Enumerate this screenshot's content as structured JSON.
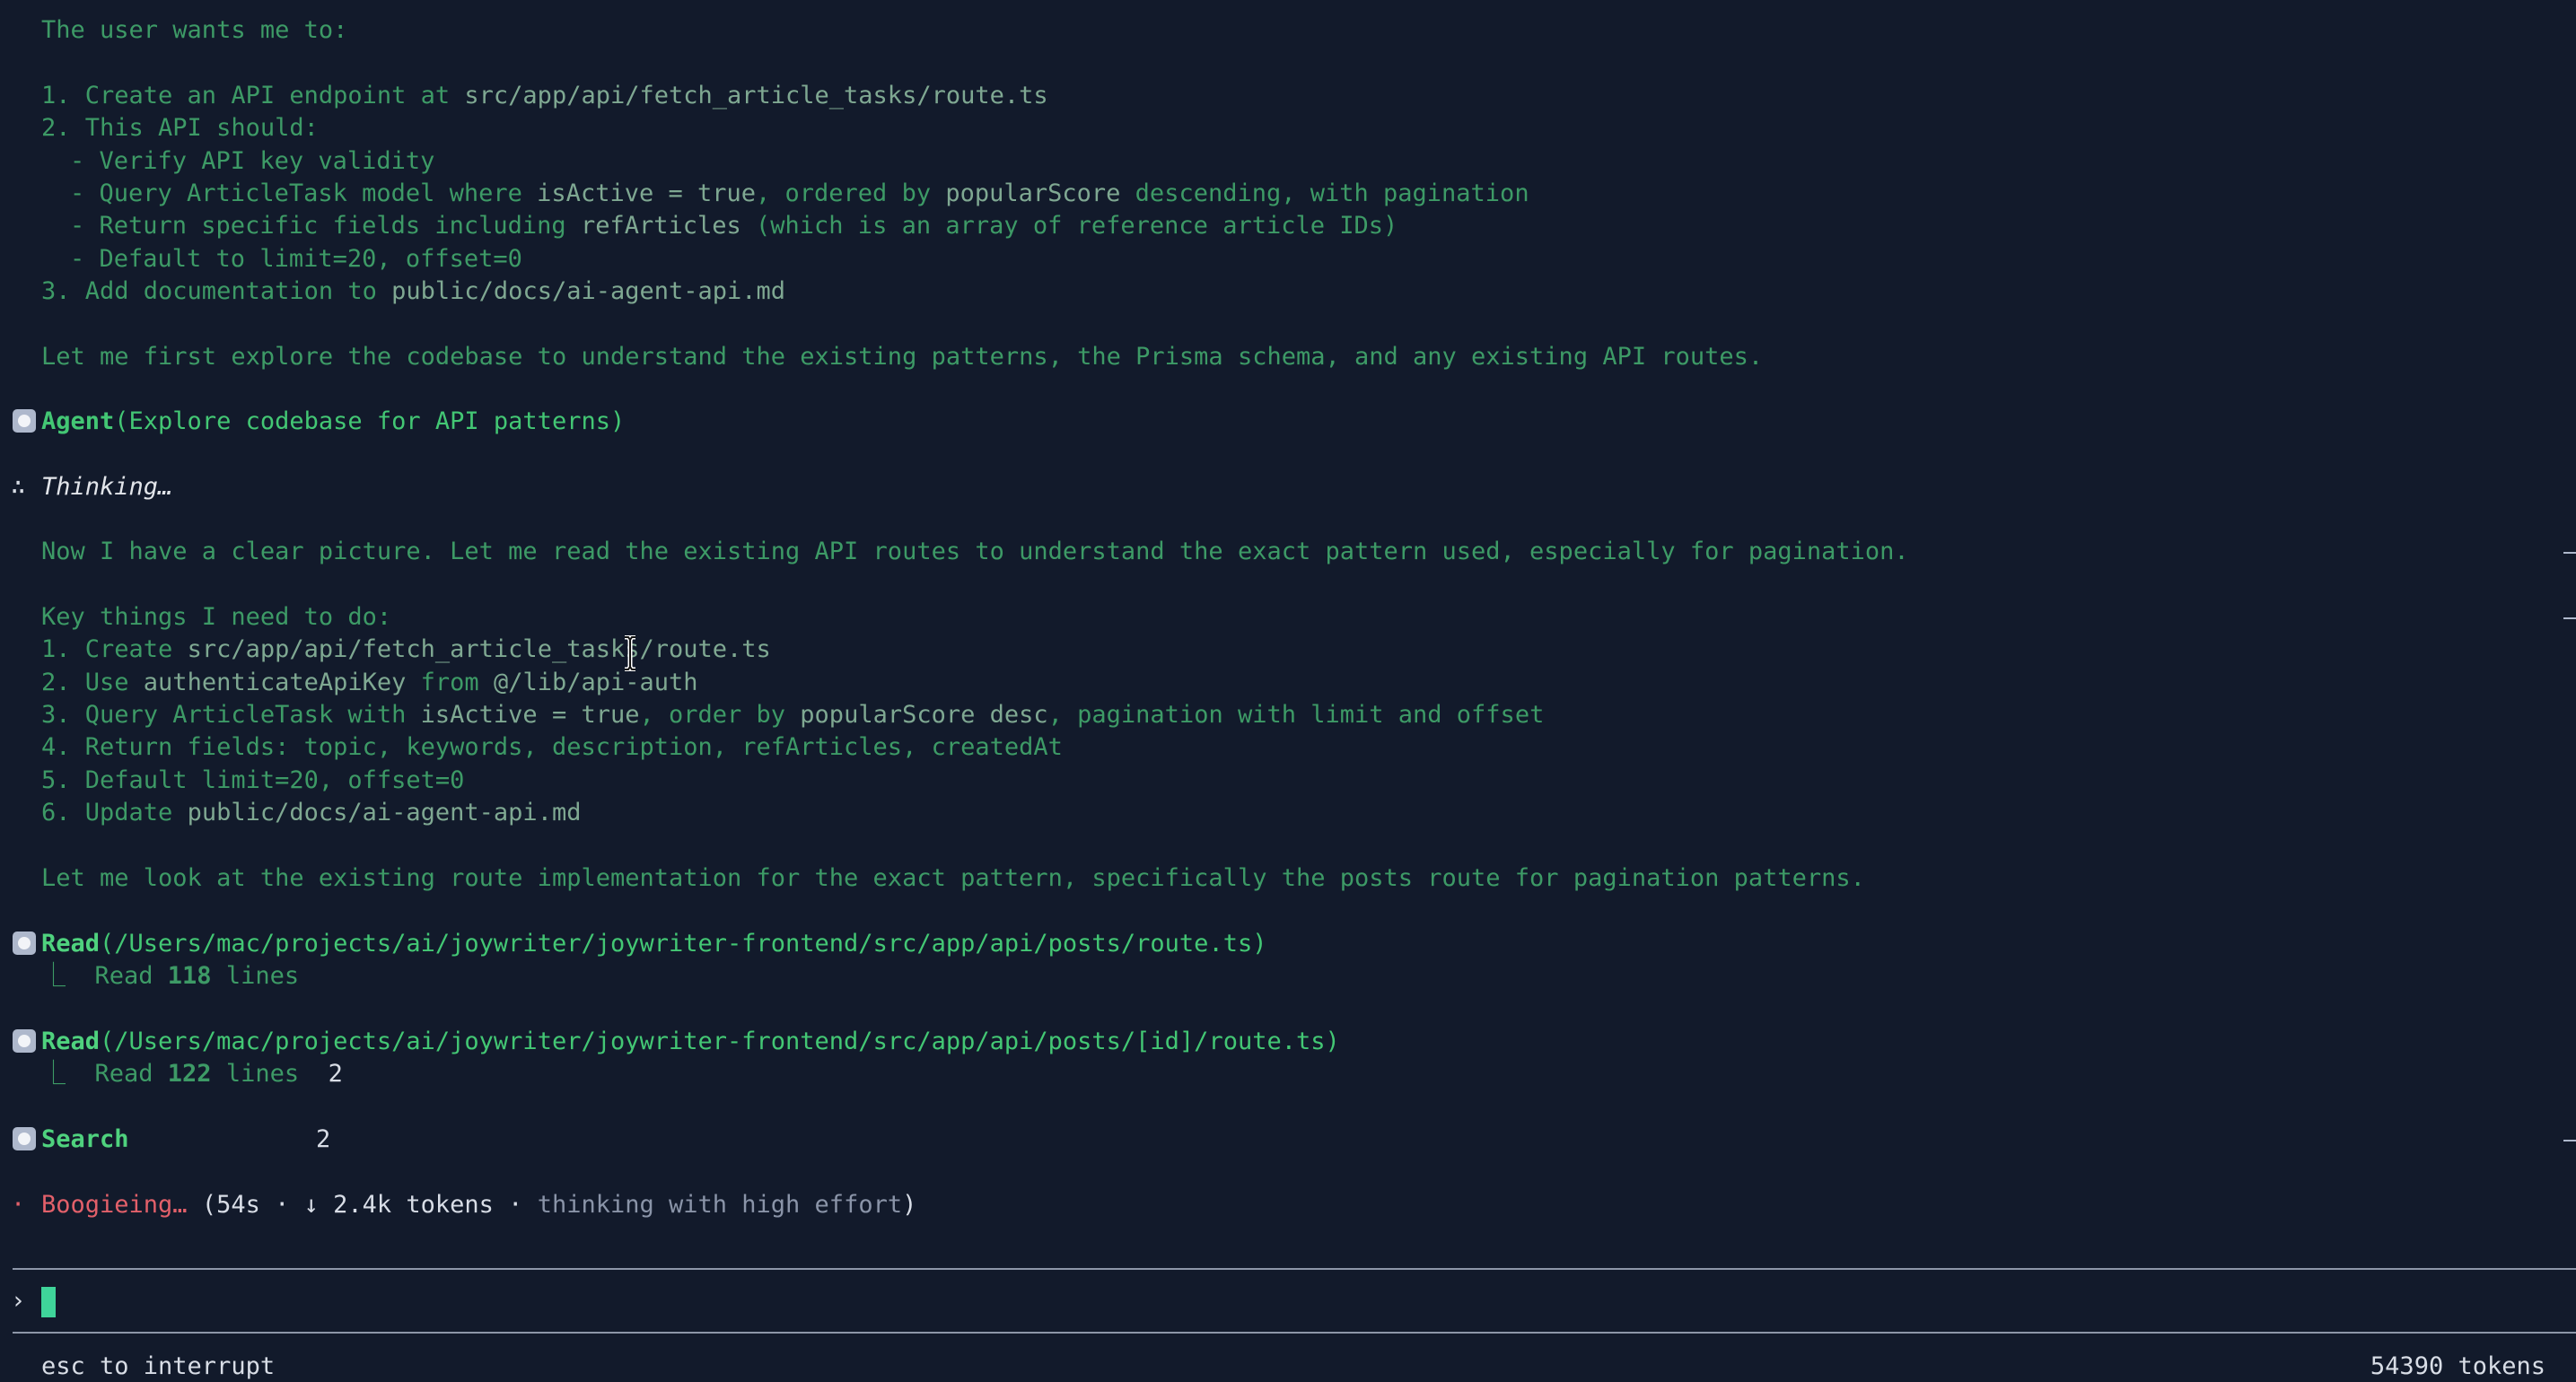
{
  "intro": {
    "line1": "The user wants me to:",
    "l2": "1. Create an API endpoint at ",
    "l2_path": "src/app/api/fetch_article_tasks/route.ts",
    "l3": "2. This API should:",
    "l4": "- Verify API key validity",
    "l5a": "- Query ArticleTask model where ",
    "l5b": "isActive = true",
    "l5c": ", ordered by ",
    "l5d": "popularScore",
    "l5e": " descending, with pagination",
    "l6a": "- Return specific fields including ",
    "l6b": "refArticles",
    "l6c": " (which is an array of reference article IDs)",
    "l7": "- Default to limit=20, offset=0",
    "l8a": "3. Add documentation to ",
    "l8b": "public/docs/ai-agent-api.md",
    "l9": "Let me first explore the codebase to understand the existing patterns, the Prisma schema, and any existing API routes."
  },
  "agent": {
    "name": "Agent",
    "args": "(Explore codebase for API patterns)"
  },
  "thinking": {
    "glyph": "∴",
    "label": "Thinking…",
    "p1": "Now I have a clear picture. Let me read the existing API routes to understand the exact pattern used, especially for pagination.",
    "key_title": "Key things I need to do:",
    "k1a": "1. Create ",
    "k1b": "src/app/api/fetch_article_tasks/route.ts",
    "k2a": "2. Use ",
    "k2b": "authenticateApiKey",
    "k2c": " from ",
    "k2d": "@/lib/api-auth",
    "k3a": "3. Query ArticleTask with ",
    "k3b": "isActive = true",
    "k3c": ", order by ",
    "k3d": "popularScore desc",
    "k3e": ", pagination with limit and offset",
    "k4": "4. Return fields: topic, keywords, description, refArticles, createdAt",
    "k5": "5. Default limit=20, offset=0",
    "k6a": "6. Update ",
    "k6b": "public/docs/ai-agent-api.md",
    "p2": "Let me look at the existing route implementation for the exact pattern, specifically the posts route for pagination patterns."
  },
  "tools": [
    {
      "name": "Read",
      "args": "(/Users/mac/projects/ai/joywriter/joywriter-frontend/src/app/api/posts/route.ts)",
      "result_prefix": "⎿  Read ",
      "result_count": "118",
      "result_suffix": " lines",
      "extra": ""
    },
    {
      "name": "Read",
      "args": "(/Users/mac/projects/ai/joywriter/joywriter-frontend/src/app/api/posts/[id]/route.ts)",
      "result_prefix": "⎿  Read ",
      "result_count": "122",
      "result_suffix": " lines",
      "extra": "2"
    },
    {
      "name": "Search",
      "extra": "2"
    }
  ],
  "status": {
    "glyph": "·",
    "verb": "Boogieing…",
    "detail_a": " (54s · ↓ 2.4k tokens · ",
    "detail_b": "thinking with high effort",
    "detail_c": ")"
  },
  "prompt": {
    "glyph": "›"
  },
  "footer": {
    "hint": "esc to interrupt",
    "tokens": "54390 tokens"
  },
  "colors": {
    "background": "#121a2b",
    "text_green": "#3d9a66",
    "tool_green": "#4fd27e",
    "status_red": "#e2606a",
    "cursor": "#3fd49a"
  },
  "icons": [
    "tool-bullet-icon",
    "text-cursor-icon"
  ]
}
